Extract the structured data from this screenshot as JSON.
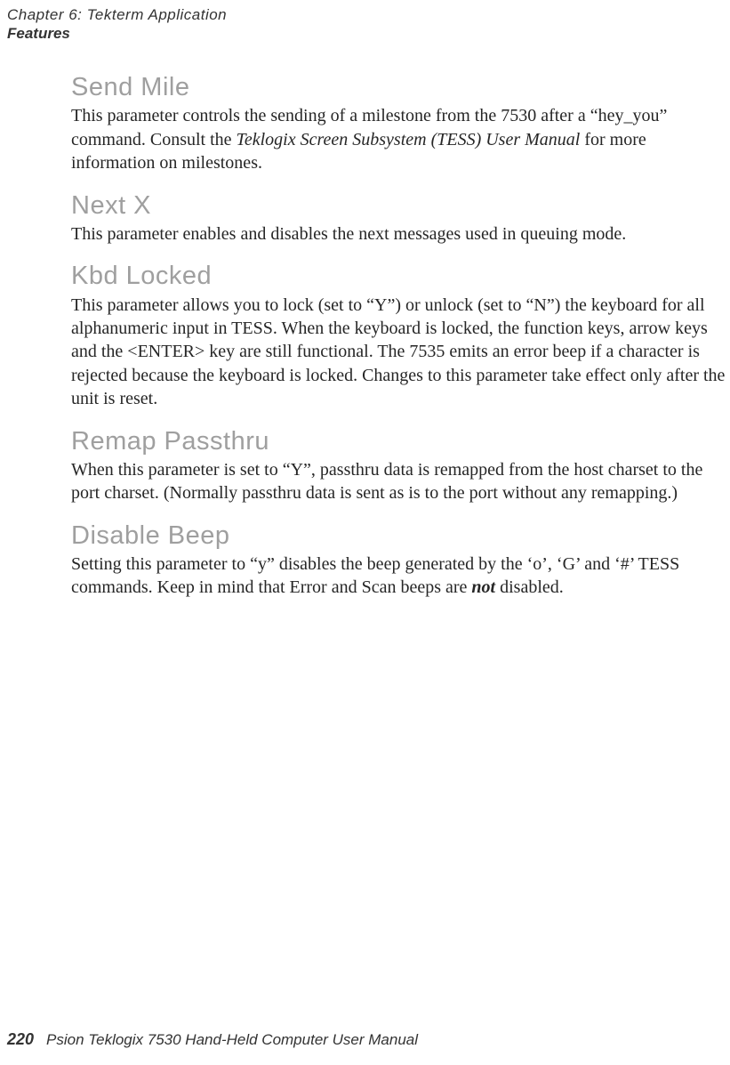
{
  "header": {
    "chapter_line": "Chapter  6:  Tekterm Application",
    "section_line": "Features"
  },
  "sections": [
    {
      "heading": "Send Mile",
      "body_parts": [
        {
          "t": "This parameter controls the sending of a milestone from the 7530 after a “hey_you” command. Consult the "
        },
        {
          "t": "Teklogix Screen Subsystem (TESS) User Manual",
          "cls": "ital"
        },
        {
          "t": " for more information on milestones."
        }
      ]
    },
    {
      "heading": "Next X",
      "body_parts": [
        {
          "t": "This parameter enables and disables the next messages used in queuing mode."
        }
      ]
    },
    {
      "heading": "Kbd Locked",
      "body_parts": [
        {
          "t": "This parameter allows you to lock (set to “Y”) or unlock (set to “N”) the keyboard for all alphanumeric input in TESS. When the keyboard is locked, the function keys, arrow keys and the <ENTER> key are still functional. The 7535 emits an error beep if a character is rejected because the keyboard is locked. Changes to this parameter take effect only after the unit is reset."
        }
      ]
    },
    {
      "heading": "Remap Passthru",
      "body_parts": [
        {
          "t": "When this parameter is set to “Y”, passthru data is remapped from the host charset to the port charset. (Normally passthru data is sent as is to the port without any remapping.)"
        }
      ]
    },
    {
      "heading": "Disable Beep",
      "body_parts": [
        {
          "t": "Setting this parameter to “y” disables the beep generated by the ‘o’, ‘G’ and ‘#’ TESS commands. Keep in mind that Error and Scan beeps are "
        },
        {
          "t": "not",
          "cls": "bital"
        },
        {
          "t": " disabled."
        }
      ]
    }
  ],
  "footer": {
    "page_number": "220",
    "manual_title": "Psion Teklogix 7530 Hand-Held Computer User Manual"
  }
}
